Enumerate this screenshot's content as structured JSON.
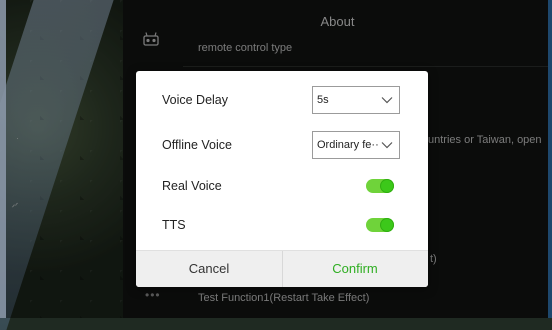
{
  "background": {
    "panel_title": "About",
    "rows": [
      {
        "text": "remote control type"
      },
      {
        "text": "untries or Taiwan, open"
      },
      {
        "text": "t)"
      },
      {
        "text": "Test Function1(Restart Take Effect)"
      }
    ]
  },
  "dialog": {
    "voice_delay": {
      "label": "Voice Delay",
      "value": "5s"
    },
    "offline_voice": {
      "label": "Offline Voice",
      "value": "Ordinary fe··"
    },
    "real_voice": {
      "label": "Real Voice",
      "on": true
    },
    "tts": {
      "label": "TTS",
      "on": true
    },
    "cancel_label": "Cancel",
    "confirm_label": "Confirm"
  },
  "colors": {
    "accent": "#3cc81a",
    "confirm_text": "#2fae22"
  },
  "icons": {
    "remote": "remote-controller-icon",
    "more": "more-icon",
    "chevron": "chevron-down-icon"
  }
}
